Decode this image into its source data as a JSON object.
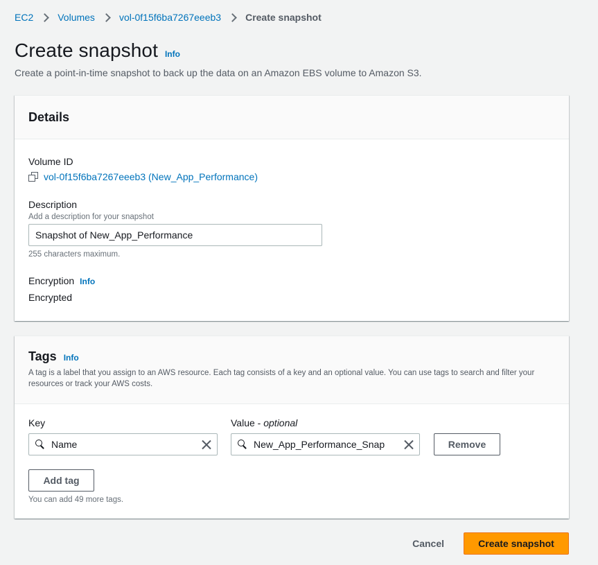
{
  "breadcrumb": {
    "items": [
      "EC2",
      "Volumes",
      "vol-0f15f6ba7267eeeb3"
    ],
    "current": "Create snapshot"
  },
  "header": {
    "title": "Create snapshot",
    "info": "Info",
    "description": "Create a point-in-time snapshot to back up the data on an Amazon EBS volume to Amazon S3."
  },
  "details": {
    "title": "Details",
    "volume_id_label": "Volume ID",
    "volume_id_value": "vol-0f15f6ba7267eeeb3 (New_App_Performance)",
    "description_label": "Description",
    "description_hint": "Add a description for your snapshot",
    "description_value": "Snapshot of New_App_Performance",
    "description_constraint": "255 characters maximum.",
    "encryption_label": "Encryption",
    "encryption_info": "Info",
    "encryption_value": "Encrypted"
  },
  "tags": {
    "title": "Tags",
    "info": "Info",
    "description": "A tag is a label that you assign to an AWS resource. Each tag consists of a key and an optional value. You can use tags to search and filter your resources or track your AWS costs.",
    "key_label": "Key",
    "value_label": "Value",
    "value_optional": "optional",
    "rows": [
      {
        "key": "Name",
        "value": "New_App_Performance_Snap"
      }
    ],
    "remove_label": "Remove",
    "add_tag_label": "Add tag",
    "remaining": "You can add 49 more tags."
  },
  "footer": {
    "cancel_label": "Cancel",
    "submit_label": "Create snapshot"
  },
  "colors": {
    "primary": "#ff9900",
    "link": "#0073bb",
    "background": "#f2f3f3"
  }
}
